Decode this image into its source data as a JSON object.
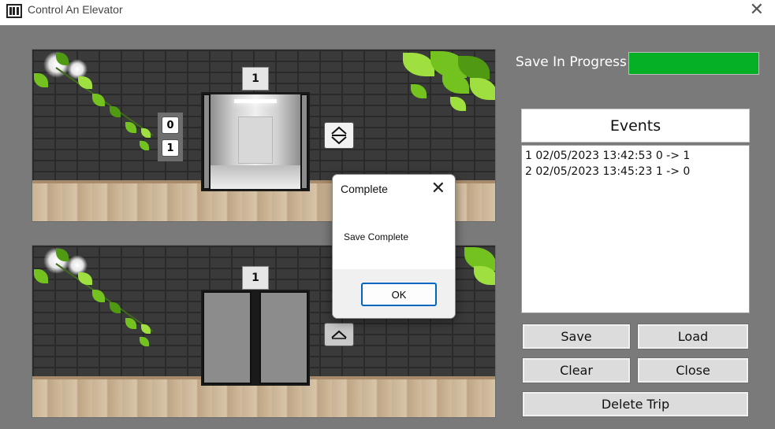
{
  "window": {
    "title": "Control An Elevator"
  },
  "save_status": {
    "label": "Save In Progress",
    "progress": 1.0,
    "color": "#06b025"
  },
  "elevator_top": {
    "floor_display": "1",
    "call_buttons": [
      "0",
      "1"
    ],
    "doors": "open",
    "direction_icon": "up-down-arrows-icon"
  },
  "elevator_bottom": {
    "floor_display": "1",
    "doors": "closed",
    "direction_icon": "up-arrow-icon"
  },
  "events": {
    "header": "Events",
    "items": [
      "1 02/05/2023 13:42:53 0 -> 1",
      "2 02/05/2023 13:45:23 1 -> 0"
    ]
  },
  "buttons": {
    "save": "Save",
    "load": "Load",
    "clear": "Clear",
    "close": "Close",
    "delete_trip": "Delete Trip"
  },
  "dialog": {
    "title": "Complete",
    "message": "Save Complete",
    "ok": "OK"
  }
}
